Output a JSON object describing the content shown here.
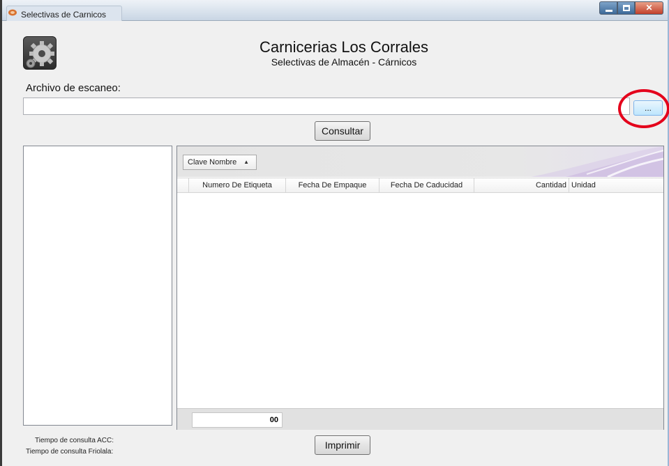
{
  "window": {
    "title": "Selectivas de Carnicos",
    "icon": "app-meat-icon",
    "controls": [
      "minimize-icon",
      "maximize-icon",
      "close-icon"
    ]
  },
  "header": {
    "logo_icon": "gear-icon",
    "title": "Carnicerias Los Corrales",
    "subtitle": "Selectivas de Almacén - Cárnicos"
  },
  "file": {
    "label": "Archivo de escaneo:",
    "value": "",
    "placeholder": "",
    "browse_label": "...",
    "highlight_color": "#e4001b"
  },
  "actions": {
    "consultar_label": "Consultar",
    "imprimir_label": "Imprimir"
  },
  "grid": {
    "group_by_label": "Clave Nombre",
    "sort_icon": "sort-ascending-icon",
    "columns": [
      "Numero De Etiqueta",
      "Fecha De Empaque",
      "Fecha De Caducidad",
      "Cantidad",
      "Unidad"
    ],
    "rows": [],
    "footer_total": "00"
  },
  "timing": {
    "acc_label": "Tiempo de consulta ACC:",
    "friolala_label": "Tiempo de consulta Friolala:"
  }
}
